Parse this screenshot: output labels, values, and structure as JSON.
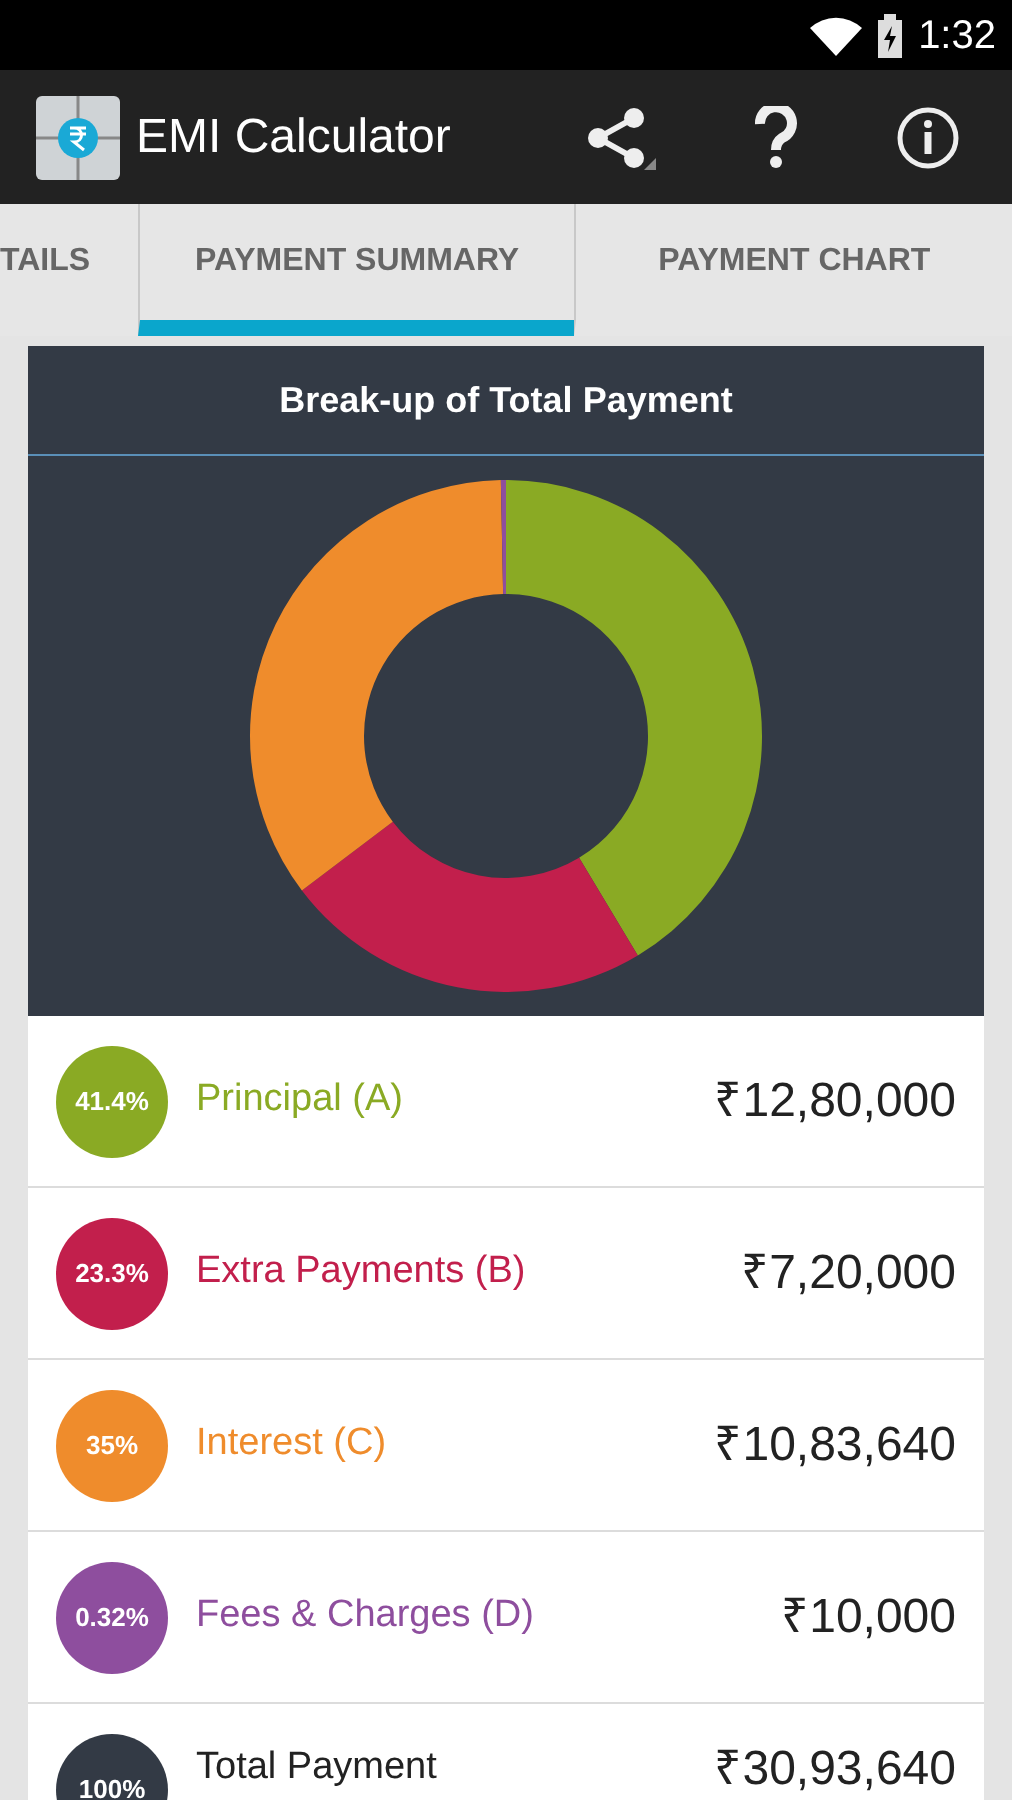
{
  "status_bar": {
    "time": "1:32"
  },
  "app_bar": {
    "title": "EMI Calculator"
  },
  "tabs": [
    {
      "label": "TAILS",
      "selected": false
    },
    {
      "label": "PAYMENT SUMMARY",
      "selected": true
    },
    {
      "label": "PAYMENT CHART",
      "selected": false
    }
  ],
  "card": {
    "title": "Break-up of Total Payment",
    "chart_data": {
      "type": "donut",
      "values": [
        41.4,
        23.3,
        35,
        0.32
      ],
      "colors": [
        "#8aaa24",
        "#c21f4c",
        "#ef8c2c",
        "#8e4e9e"
      ]
    },
    "rows": [
      {
        "percent": "41.4%",
        "label": "Principal (A)",
        "amount": "₹12,80,000",
        "color": "#8aaa24"
      },
      {
        "percent": "23.3%",
        "label": "Extra Payments (B)",
        "amount": "₹7,20,000",
        "color": "#c21f4c"
      },
      {
        "percent": "35%",
        "label": "Interest (C)",
        "amount": "₹10,83,640",
        "color": "#ef8c2c"
      },
      {
        "percent": "0.32%",
        "label": "Fees & Charges (D)",
        "amount": "₹10,000",
        "color": "#8e4e9e"
      },
      {
        "percent": "100%",
        "label": "Total Payment",
        "amount": "₹30,93,640",
        "color": "#333a45"
      }
    ]
  }
}
